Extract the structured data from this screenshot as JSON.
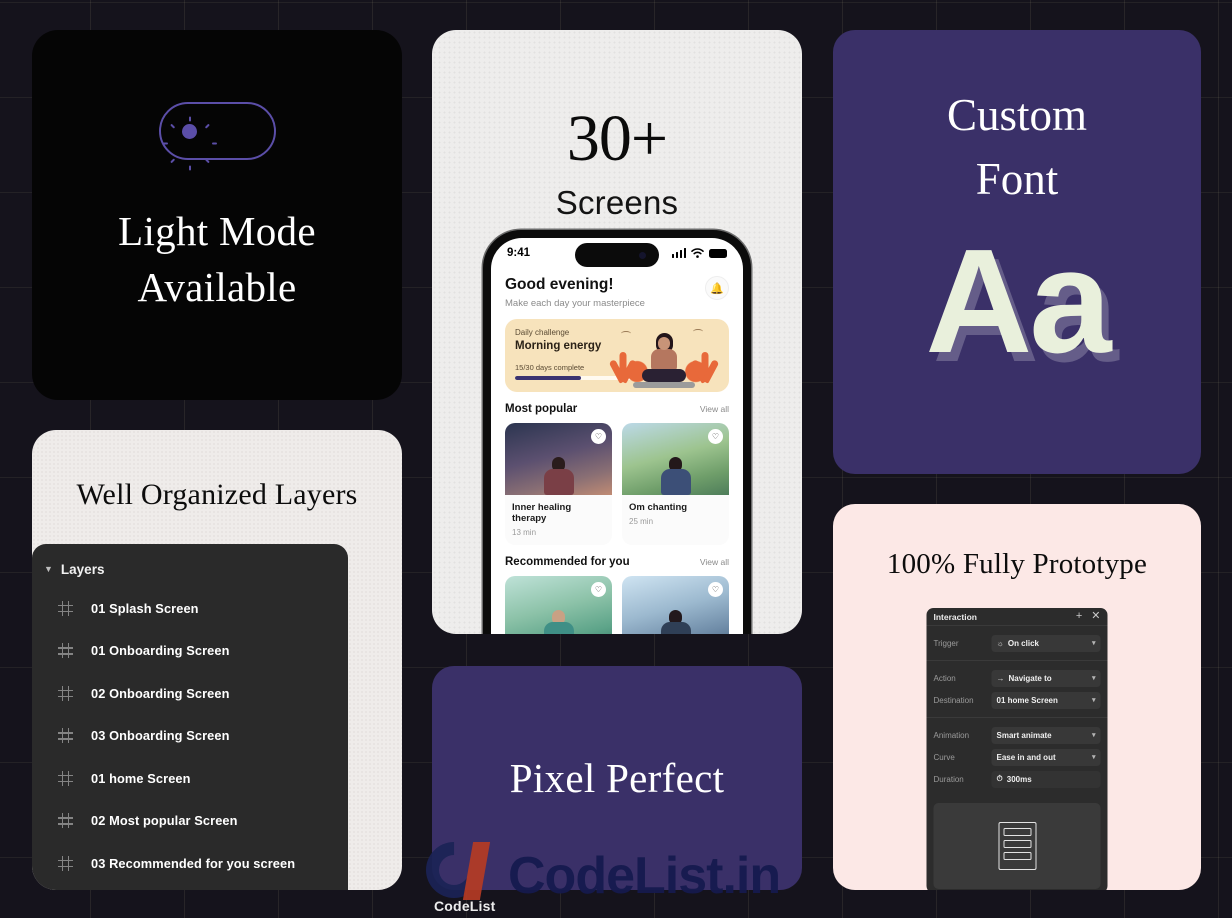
{
  "theme": {
    "bg": "#15131c",
    "purple": "#3a3068",
    "pink": "#fce8e6",
    "light_gray": "#efecea",
    "accent_violet": "#5b4ea8",
    "cream": "#e9f0dc"
  },
  "light_mode_card": {
    "toggle_icon": "sun-icon",
    "line1": "Light Mode",
    "line2": "Available"
  },
  "layers_card": {
    "title": "Well Organized Layers",
    "panel": {
      "caret_icon": "chevron-down-icon",
      "header": "Layers",
      "items": [
        {
          "icon": "frame-icon",
          "label": "01 Splash Screen"
        },
        {
          "icon": "frame-icon",
          "label": "01 Onboarding Screen"
        },
        {
          "icon": "frame-icon",
          "label": "02 Onboarding Screen"
        },
        {
          "icon": "frame-icon",
          "label": "03 Onboarding Screen"
        },
        {
          "icon": "frame-icon",
          "label": "01 home Screen"
        },
        {
          "icon": "frame-icon",
          "label": "02 Most popular Screen"
        },
        {
          "icon": "frame-icon",
          "label": "03 Recommended for you screen"
        }
      ]
    }
  },
  "screens_card": {
    "count": "30+",
    "subtitle": "Screens",
    "phone": {
      "status_bar": {
        "time": "9:41",
        "signal_icon": "cellular-bars-icon",
        "wifi_icon": "wifi-icon",
        "battery_icon": "battery-icon"
      },
      "greeting": "Good evening!",
      "tagline": "Make each day your masterpiece",
      "notification_icon": "bell-icon",
      "challenge": {
        "label": "Daily challenge",
        "title": "Morning energy",
        "progress_text": "15/30 days complete",
        "progress_percent": 50
      },
      "sections": [
        {
          "title": "Most popular",
          "link": "View all",
          "tiles": [
            {
              "title": "Inner healing therapy",
              "duration": "13 min",
              "favorite_icon": "heart-icon"
            },
            {
              "title": "Om chanting",
              "duration": "25 min",
              "favorite_icon": "heart-icon"
            }
          ]
        },
        {
          "title": "Recommended for you",
          "link": "View all",
          "tiles": [
            {
              "title": "",
              "duration": "",
              "favorite_icon": "heart-icon"
            },
            {
              "title": "",
              "duration": "",
              "favorite_icon": "heart-icon"
            }
          ]
        }
      ]
    }
  },
  "pixel_card": {
    "title": "Pixel Perfect"
  },
  "font_card": {
    "line1": "Custom",
    "line2": "Font",
    "sample": "Aa"
  },
  "prototype_card": {
    "title": "100% Fully Prototype",
    "panel": {
      "title": "Interaction",
      "add_icon": "plus-icon",
      "close_icon": "close-icon",
      "rows": [
        {
          "label": "Trigger",
          "icon": "click-icon",
          "value": "On click",
          "chevron": "chevron-down-icon"
        },
        {
          "label": "Action",
          "icon": "arrow-right-icon",
          "value": "Navigate to",
          "chevron": "chevron-down-icon"
        },
        {
          "label": "Destination",
          "icon": "",
          "value": "01 home Screen",
          "chevron": "chevron-down-icon"
        },
        {
          "label": "Animation",
          "icon": "",
          "value": "Smart animate",
          "chevron": "chevron-down-icon"
        },
        {
          "label": "Curve",
          "icon": "",
          "value": "Ease in and out",
          "chevron": "chevron-down-icon"
        },
        {
          "label": "Duration",
          "icon": "timer-icon",
          "value": "300ms",
          "chevron": ""
        }
      ],
      "preview_icon": "wireframe-icon"
    }
  },
  "watermark": {
    "logo_mark": "codelist-logo-icon",
    "logo_name": "CodeList",
    "site": "CodeList.in"
  }
}
